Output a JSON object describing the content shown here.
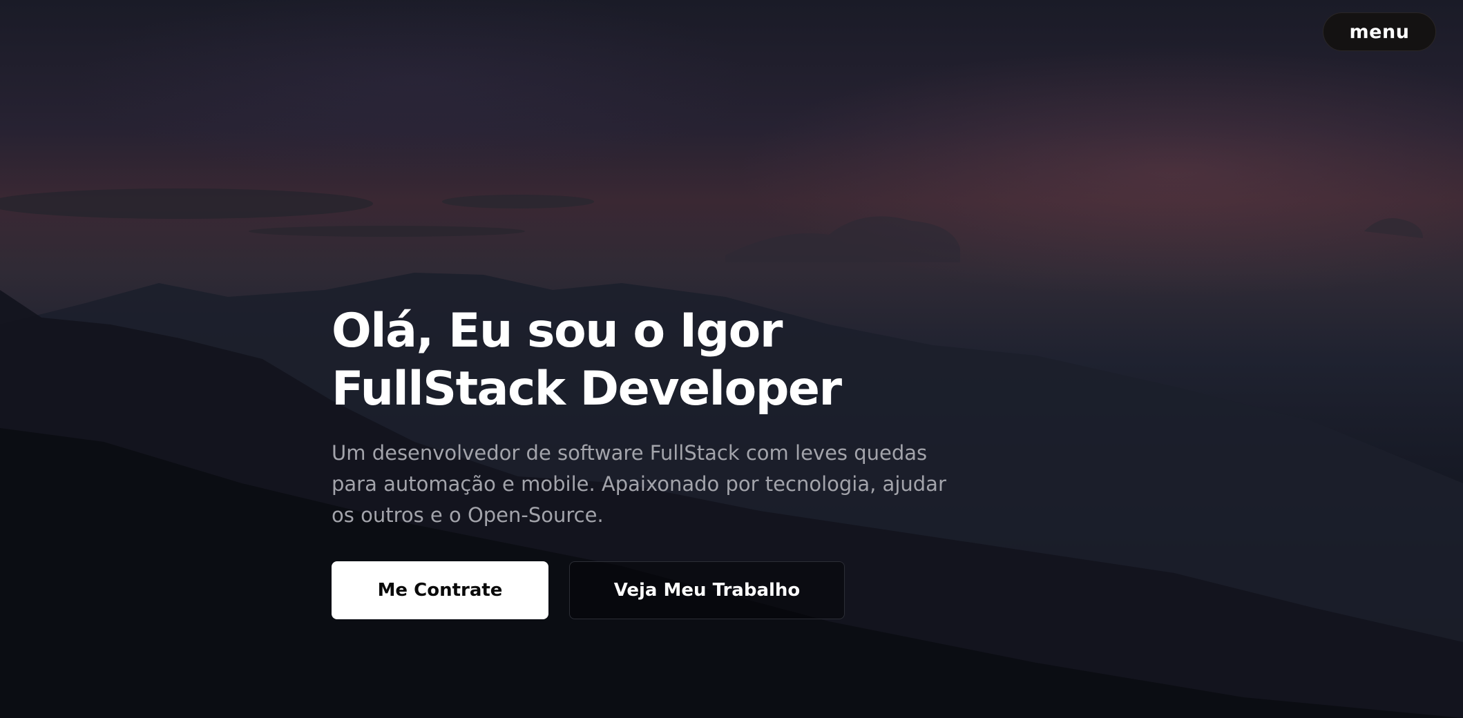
{
  "header": {
    "menu_label": "menu"
  },
  "hero": {
    "title_line1": "Olá, Eu sou o Igor",
    "title_line2": "FullStack Developer",
    "subtitle": "Um desenvolvedor de software FullStack com leves quedas para automação e mobile. Apaixonado por tecnologia, ajudar os outros e o Open-Source."
  },
  "actions": {
    "primary_label": "Me Contrate",
    "secondary_label": "Veja Meu Trabalho"
  },
  "colors": {
    "background": "#0a0b10",
    "text_primary": "#ffffff",
    "text_secondary": "#a3a4ab",
    "button_primary_bg": "#ffffff",
    "menu_bg": "#141212"
  }
}
